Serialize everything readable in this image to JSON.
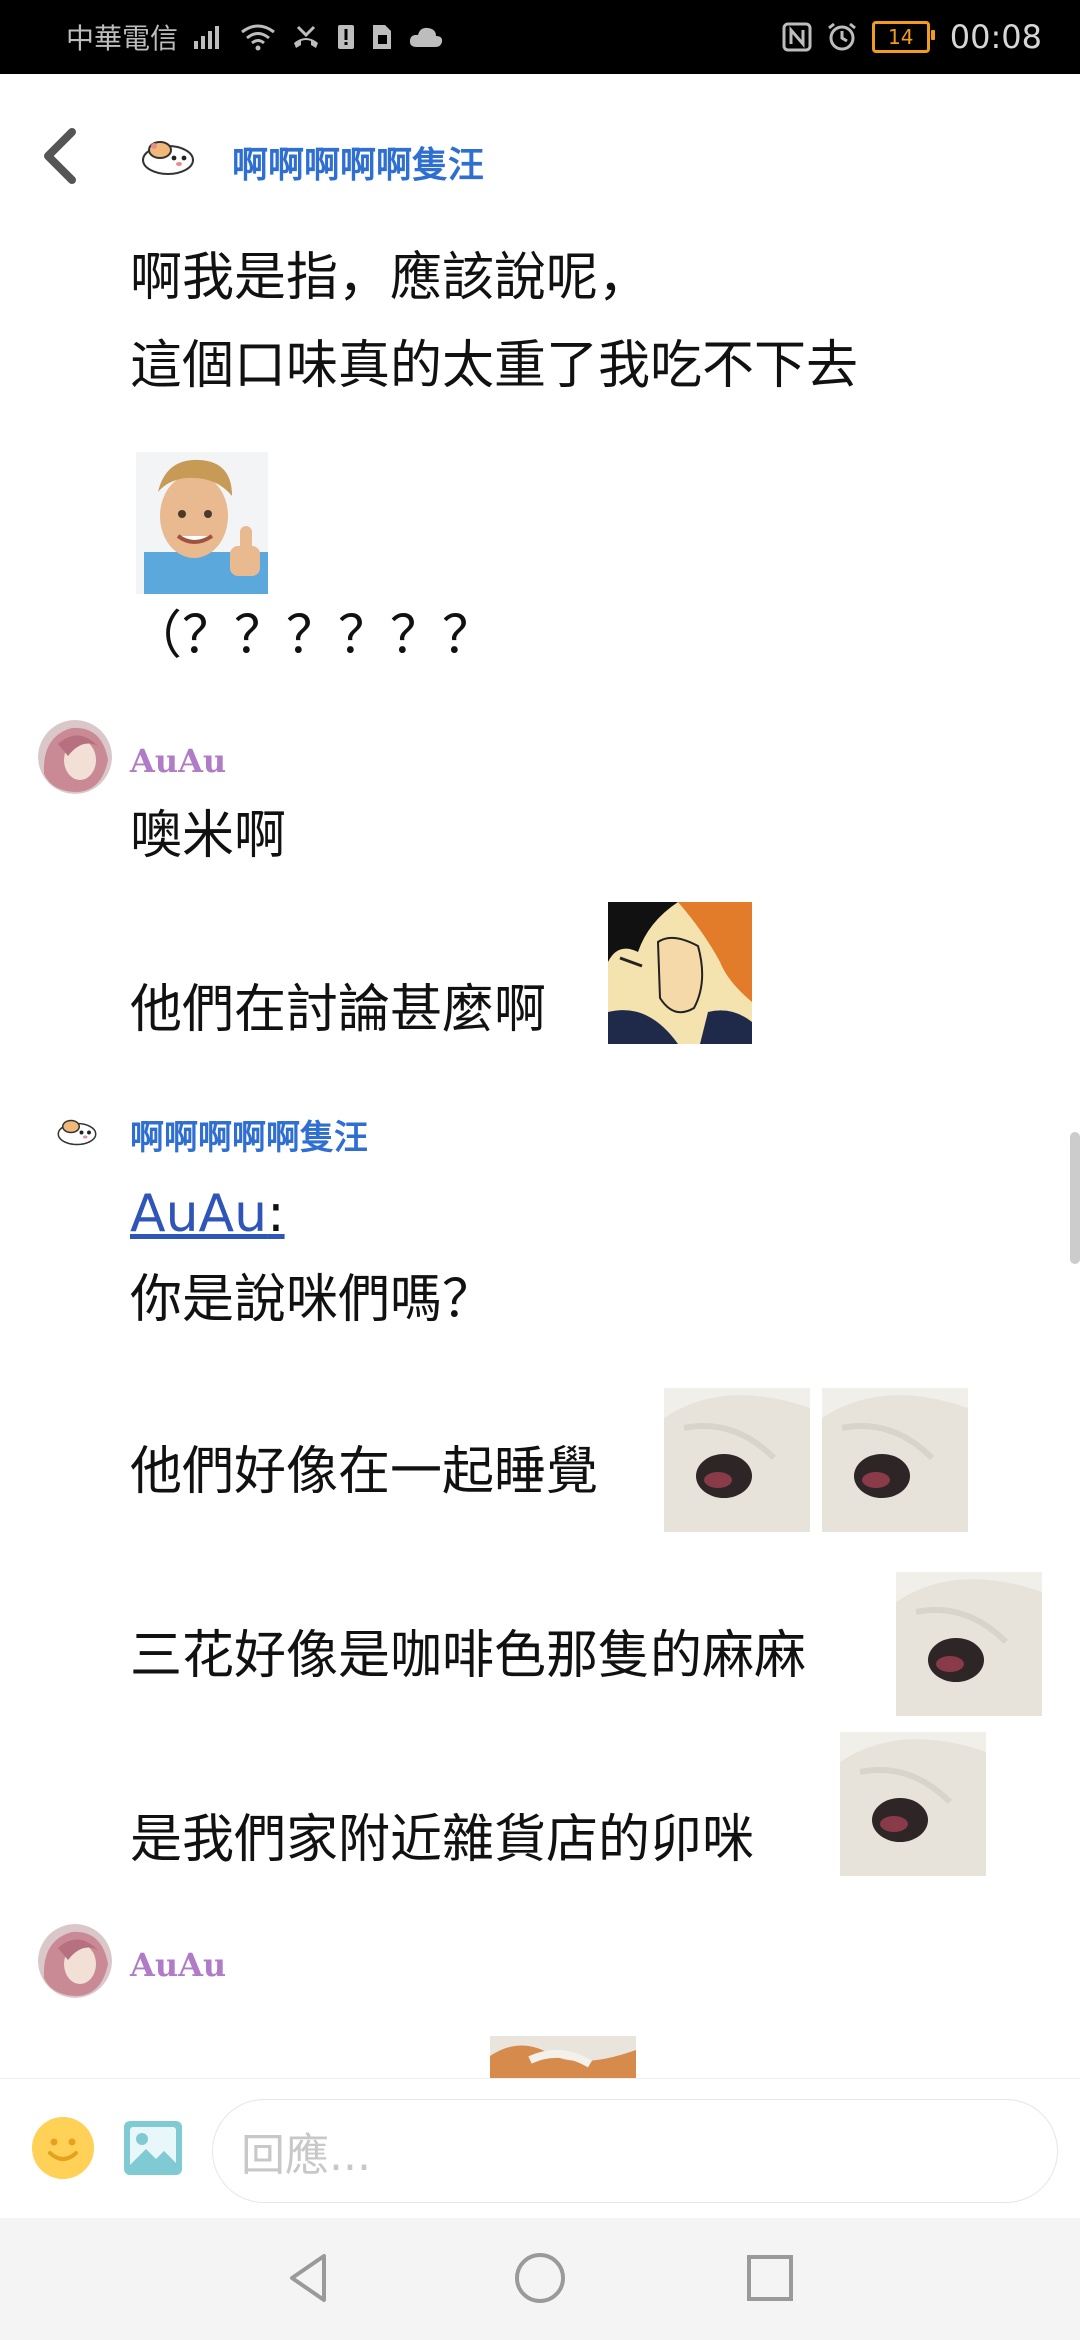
{
  "status_bar": {
    "carrier": "中華電信",
    "battery": "14",
    "time": "00:08"
  },
  "header": {
    "title": "啊啊啊啊啊隻汪"
  },
  "messages": {
    "m1_line1": "啊我是指，應該說呢，",
    "m1_line2": "這個口味真的太重了我吃不下去",
    "m1_line3": "（？？？？？？",
    "auau_name_1": "AuAu",
    "m2_line1": "噢米啊",
    "m2_line2": "他們在討論甚麼啊",
    "hamster_name": "啊啊啊啊啊隻汪",
    "mention": "AuAu",
    "mention_colon": ":",
    "m3_line1": "你是說咪們嗎？",
    "m3_line2": "他們好像在一起睡覺",
    "m3_line3": "三花好像是咖啡色那隻的麻麻",
    "m3_line4": "是我們家附近雜貨店的卯咪",
    "auau_name_2": "AuAu"
  },
  "composer": {
    "placeholder": "回應..."
  },
  "colors": {
    "accent_blue": "#2f6fd1",
    "auau_purple": "#b07cc8",
    "mention_blue": "#2f55b8"
  }
}
